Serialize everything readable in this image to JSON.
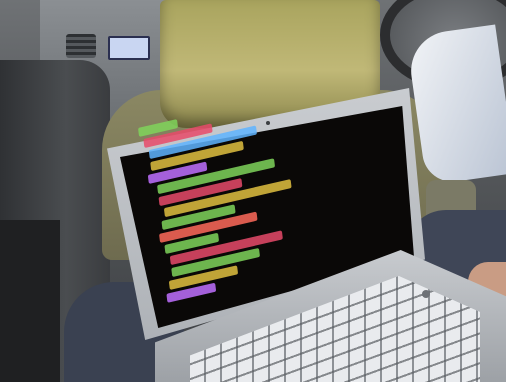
{
  "scene": {
    "colors": {
      "headrest": "#b9b26d",
      "laptop_body": "#b9bdc2",
      "screen": "#0a0807",
      "upholstery": "#5a5d60"
    },
    "code_line_colors": [
      "#7fd35a",
      "#e84a6a",
      "#5fb4ff",
      "#e0c040",
      "#c070ff",
      "#7fd35a",
      "#e84a6a",
      "#e0c040",
      "#7fd35a",
      "#ff6a5a",
      "#7fd35a",
      "#e84a6a",
      "#7fd35a",
      "#e0c040",
      "#c070ff"
    ]
  }
}
